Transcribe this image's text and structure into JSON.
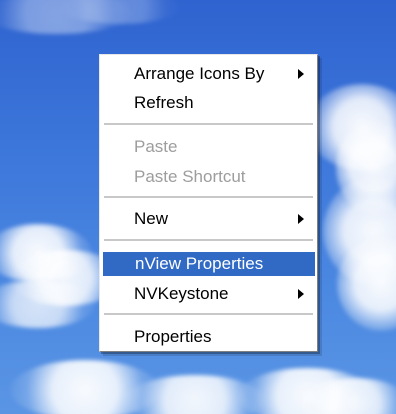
{
  "desktop_menu": {
    "items": [
      {
        "label": "Arrange Icons By",
        "has_submenu": true,
        "enabled": true
      },
      {
        "label": "Refresh",
        "has_submenu": false,
        "enabled": true
      },
      {
        "label": "Paste",
        "has_submenu": false,
        "enabled": false
      },
      {
        "label": "Paste Shortcut",
        "has_submenu": false,
        "enabled": false
      },
      {
        "label": "New",
        "has_submenu": true,
        "enabled": true
      },
      {
        "label": "nView Properties",
        "has_submenu": false,
        "enabled": true,
        "highlighted": true
      },
      {
        "label": "NVKeystone",
        "has_submenu": true,
        "enabled": true
      },
      {
        "label": "Properties",
        "has_submenu": false,
        "enabled": true
      }
    ]
  },
  "theme": {
    "highlight": "#316ac5",
    "disabled_text": "#9d9d9d",
    "menu_background": "#ffffff"
  }
}
